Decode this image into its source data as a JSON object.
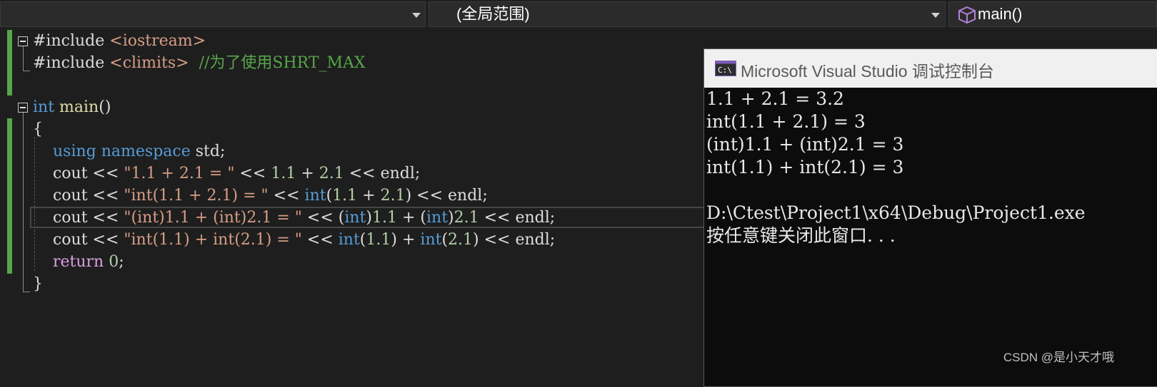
{
  "navbar": {
    "left_combo": "",
    "scope_combo": "(全局范围)",
    "function_combo": "main()"
  },
  "editor": {
    "lines": [
      {
        "parts": [
          {
            "t": "#include ",
            "c": ""
          },
          {
            "t": "<iostream>",
            "c": "ang"
          }
        ]
      },
      {
        "parts": [
          {
            "t": "#include ",
            "c": ""
          },
          {
            "t": "<climits>",
            "c": "ang"
          },
          {
            "t": "  ",
            "c": ""
          },
          {
            "t": "//为了使用SHRT_MAX",
            "c": "cmt"
          }
        ]
      },
      {
        "parts": []
      },
      {
        "parts": [
          {
            "t": "int",
            "c": "kw"
          },
          {
            "t": " ",
            "c": ""
          },
          {
            "t": "main",
            "c": "fn"
          },
          {
            "t": "()",
            "c": ""
          }
        ]
      },
      {
        "parts": [
          {
            "t": "{",
            "c": ""
          }
        ]
      },
      {
        "parts": [
          {
            "t": "    ",
            "c": ""
          },
          {
            "t": "using",
            "c": "kw"
          },
          {
            "t": " ",
            "c": ""
          },
          {
            "t": "namespace",
            "c": "kw"
          },
          {
            "t": " std;",
            "c": ""
          }
        ]
      },
      {
        "parts": [
          {
            "t": "    cout << ",
            "c": ""
          },
          {
            "t": "\"1.1 + 2.1 = \"",
            "c": "str"
          },
          {
            "t": " << ",
            "c": ""
          },
          {
            "t": "1.1",
            "c": "num"
          },
          {
            "t": " + ",
            "c": ""
          },
          {
            "t": "2.1",
            "c": "num"
          },
          {
            "t": " << endl;",
            "c": ""
          }
        ]
      },
      {
        "parts": [
          {
            "t": "    cout << ",
            "c": ""
          },
          {
            "t": "\"int(1.1 + 2.1) = \"",
            "c": "str"
          },
          {
            "t": " << ",
            "c": ""
          },
          {
            "t": "int",
            "c": "kw"
          },
          {
            "t": "(",
            "c": ""
          },
          {
            "t": "1.1",
            "c": "num"
          },
          {
            "t": " + ",
            "c": ""
          },
          {
            "t": "2.1",
            "c": "num"
          },
          {
            "t": ") << endl;",
            "c": ""
          }
        ]
      },
      {
        "parts": [
          {
            "t": "    cout << ",
            "c": ""
          },
          {
            "t": "\"(int)1.1 + (int)2.1 = \"",
            "c": "str"
          },
          {
            "t": " << (",
            "c": ""
          },
          {
            "t": "int",
            "c": "kw"
          },
          {
            "t": ")",
            "c": ""
          },
          {
            "t": "1.1",
            "c": "num"
          },
          {
            "t": " + (",
            "c": ""
          },
          {
            "t": "int",
            "c": "kw"
          },
          {
            "t": ")",
            "c": ""
          },
          {
            "t": "2.1",
            "c": "num"
          },
          {
            "t": " << endl;",
            "c": ""
          }
        ]
      },
      {
        "parts": [
          {
            "t": "    cout << ",
            "c": ""
          },
          {
            "t": "\"int(1.1) + int(2.1) = \"",
            "c": "str"
          },
          {
            "t": " << ",
            "c": ""
          },
          {
            "t": "int",
            "c": "kw"
          },
          {
            "t": "(",
            "c": ""
          },
          {
            "t": "1.1",
            "c": "num"
          },
          {
            "t": ") + ",
            "c": ""
          },
          {
            "t": "int",
            "c": "kw"
          },
          {
            "t": "(",
            "c": ""
          },
          {
            "t": "2.1",
            "c": "num"
          },
          {
            "t": ") << endl;",
            "c": ""
          }
        ]
      },
      {
        "parts": [
          {
            "t": "    ",
            "c": ""
          },
          {
            "t": "return",
            "c": "kwc"
          },
          {
            "t": " ",
            "c": ""
          },
          {
            "t": "0",
            "c": "num"
          },
          {
            "t": ";",
            "c": ""
          }
        ]
      },
      {
        "parts": [
          {
            "t": "}",
            "c": ""
          }
        ]
      }
    ]
  },
  "console": {
    "title": "Microsoft Visual Studio 调试控制台",
    "icon": "console-app-icon",
    "lines": [
      "1.1 + 2.1 = 3.2",
      "int(1.1 + 2.1) = 3",
      "(int)1.1 + (int)2.1 = 3",
      "int(1.1) + int(2.1) = 3",
      "",
      "D:\\Ctest\\Project1\\x64\\Debug\\Project1.exe",
      "按任意键关闭此窗口. . ."
    ]
  },
  "watermark": "CSDN @是小天才哦",
  "colors": {
    "keyword": "#569cd6",
    "control_keyword": "#d8a0df",
    "string": "#d69d85",
    "number": "#b5cea8",
    "comment": "#57a64a",
    "function": "#dcdcaa",
    "change_bar": "#57a64a"
  }
}
